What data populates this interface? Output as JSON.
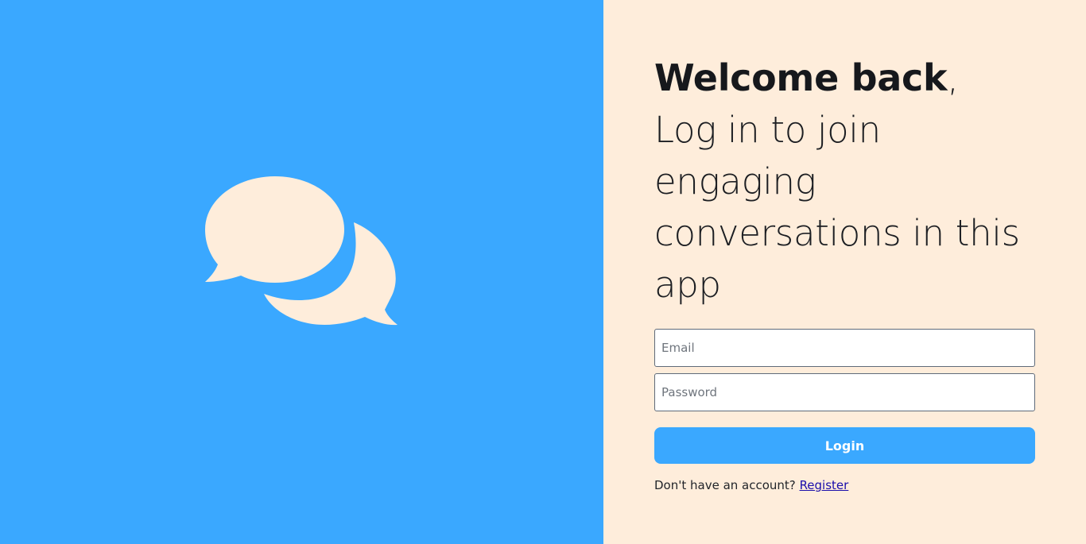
{
  "left_panel": {
    "background_color": "#3aa8ff",
    "icon": "chat-bubbles-icon",
    "icon_color": "#feeddb"
  },
  "right_panel": {
    "background_color": "#feeddb",
    "heading": {
      "bold_text": "Welcome back",
      "comma": ",",
      "subtitle": "Log in to join engaging conversations in this app"
    },
    "form": {
      "email_placeholder": "Email",
      "email_value": "",
      "password_placeholder": "Password",
      "password_value": "",
      "login_label": "Login",
      "login_button_color": "#3aa8ff"
    },
    "register_prompt": "Don't have an account?",
    "register_link": "Register"
  }
}
